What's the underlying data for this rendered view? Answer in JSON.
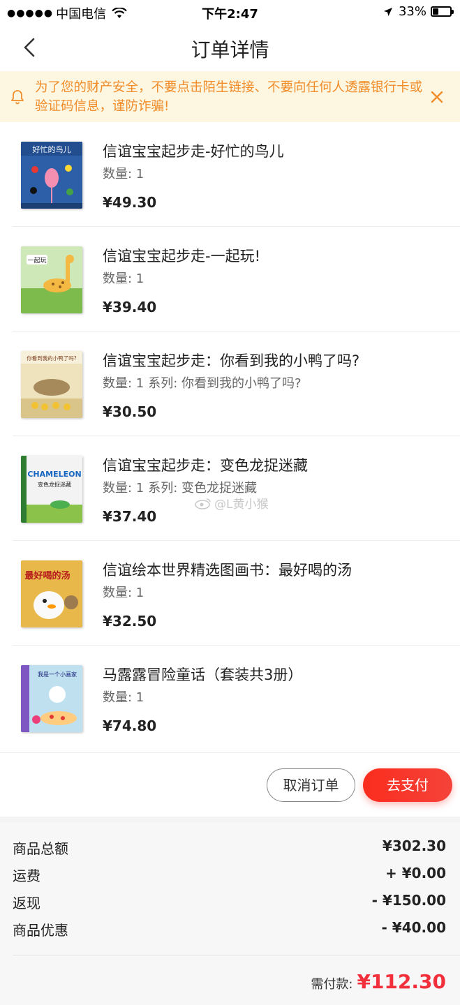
{
  "status_bar": {
    "signal": "●●●●●",
    "carrier": "中国电信",
    "time": "下午2:47",
    "battery_text": "33%",
    "battery_level": 0.33
  },
  "nav": {
    "title": "订单详情",
    "back_icon": "chevron-left-icon"
  },
  "notice": {
    "text": "为了您的财产安全，不要点击陌生链接、不要向任何人透露银行卡或验证码信息，谨防诈骗!",
    "icon": "bell-icon",
    "close_icon": "close-icon"
  },
  "items": [
    {
      "name": "信谊宝宝起步走-好忙的鸟儿",
      "quantity": "数量: 1",
      "series": "",
      "price": "¥49.30",
      "cover_title": "好忙的鸟儿",
      "cover_color": "#2c5fa8"
    },
    {
      "name": "信谊宝宝起步走-一起玩!",
      "quantity": "数量: 1",
      "series": "",
      "price": "¥39.40",
      "cover_title": "一起玩",
      "cover_color": "#7dbb4c"
    },
    {
      "name": "信谊宝宝起步走：你看到我的小鸭了吗?",
      "quantity": "数量: 1",
      "series": "系列: 你看到我的小鸭了吗?",
      "price": "¥30.50",
      "cover_title": "你看到我的小鸭了吗?",
      "cover_color": "#d9c58a"
    },
    {
      "name": "信谊宝宝起步走：变色龙捉迷藏",
      "quantity": "数量: 1",
      "series": "系列: 变色龙捉迷藏",
      "price": "¥37.40",
      "cover_title": "CHAMELEON",
      "cover_subtitle": "变色龙捉迷藏",
      "cover_color": "#f3f3f3"
    },
    {
      "name": "信谊绘本世界精选图画书：最好喝的汤",
      "quantity": "数量: 1",
      "series": "",
      "price": "¥32.50",
      "cover_title": "最好喝的汤",
      "cover_color": "#e9b84a"
    },
    {
      "name": "马露露冒险童话（套装共3册）",
      "quantity": "数量: 1",
      "series": "",
      "price": "¥74.80",
      "cover_title": "我是一个小画家",
      "cover_color": "#bfe0ef"
    }
  ],
  "watermark": "@L黄小猴",
  "actions": {
    "cancel_label": "取消订单",
    "pay_label": "去支付"
  },
  "summary": {
    "rows": [
      {
        "label": "商品总额",
        "value": "¥302.30"
      },
      {
        "label": "运费",
        "value": "+ ¥0.00"
      },
      {
        "label": "返现",
        "value": "- ¥150.00"
      },
      {
        "label": "商品优惠",
        "value": "- ¥40.00"
      }
    ],
    "total_label": "需付款:",
    "total_value": "¥112.30"
  },
  "colors": {
    "accent_red": "#f2303c",
    "notice_orange": "#f08c2a",
    "notice_bg": "#fdf7e1"
  }
}
